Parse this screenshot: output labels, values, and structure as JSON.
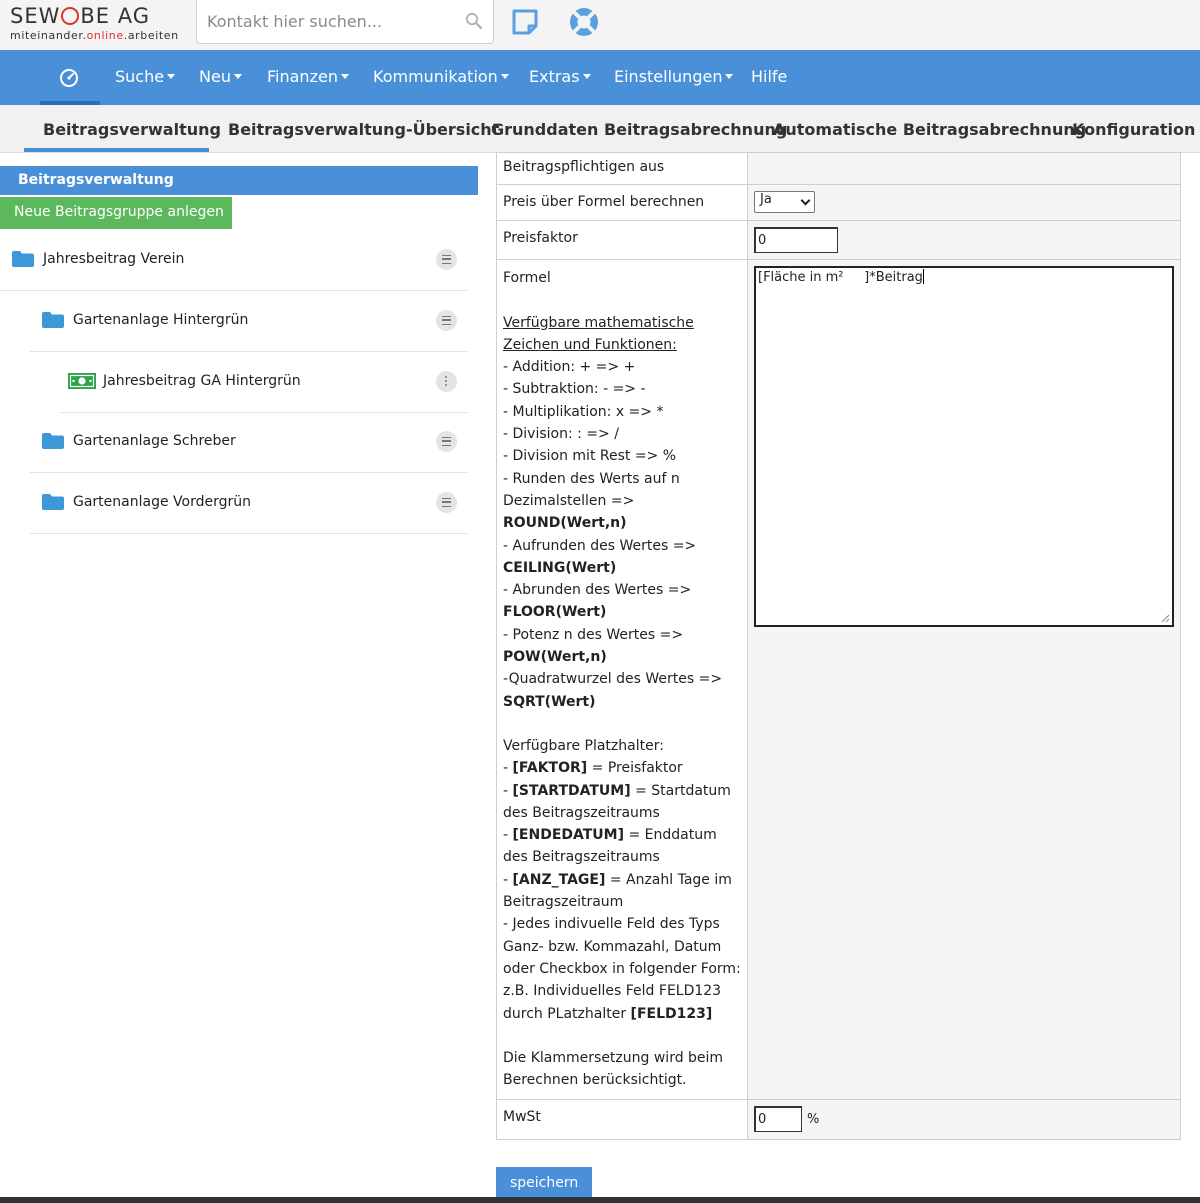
{
  "logo": {
    "main": "SEWOBE AG",
    "sub_prefix": "miteinander.",
    "sub_online": "online",
    "sub_suffix": ".arbeiten"
  },
  "search": {
    "placeholder": "Kontakt hier suchen..."
  },
  "nav": {
    "items": [
      {
        "label": "Suche",
        "dropdown": true
      },
      {
        "label": "Neu",
        "dropdown": true
      },
      {
        "label": "Finanzen",
        "dropdown": true
      },
      {
        "label": "Kommunikation",
        "dropdown": true
      },
      {
        "label": "Extras",
        "dropdown": true
      },
      {
        "label": "Einstellungen",
        "dropdown": true
      },
      {
        "label": "Hilfe",
        "dropdown": false
      }
    ]
  },
  "tabs": [
    "Beitragsverwaltung",
    "Beitragsverwaltung-Übersicht",
    "Grunddaten Beitragsabrechnung",
    "Automatische Beitragsabrechnung",
    "Konfiguration Beitragsverwaltung"
  ],
  "sidebar": {
    "header": "Beitragsverwaltung",
    "new_group_button": "Neue Beitragsgruppe anlegen",
    "tree": [
      {
        "label": "Jahresbeitrag Verein",
        "icon": "folder-icon"
      },
      {
        "label": "Gartenanlage Hintergrün",
        "icon": "folder-icon"
      },
      {
        "label": "Jahresbeitrag GA Hintergrün",
        "icon": "money-icon"
      },
      {
        "label": "Gartenanlage Schreber",
        "icon": "folder-icon"
      },
      {
        "label": "Gartenanlage Vordergrün",
        "icon": "folder-icon"
      }
    ]
  },
  "form": {
    "row_payers_label": "Beitragspflichtigen aus",
    "price_formula_label": "Preis über Formel berechnen",
    "price_formula_value": "Ja",
    "price_factor_label": "Preisfaktor",
    "price_factor_value": "0",
    "formula_label": "Formel",
    "formula_value": "[Fläche in m²     ]*Beitrag",
    "help": {
      "math_heading_1": "Verfügbare mathematische",
      "math_heading_2": "Zeichen und Funktionen:",
      "add": "- Addition: + => +",
      "sub": "- Subtraktion: - => -",
      "mul": "- Multiplikation: x => *",
      "div": "- Division: : => /",
      "mod": "- Division mit Rest => %",
      "round_1": "- Runden des Werts auf n",
      "round_2": "Dezimalstellen =>",
      "round_fn": "ROUND(Wert,n)",
      "ceil_1": "- Aufrunden des Wertes =>",
      "ceil_fn": "CEILING(Wert)",
      "floor_1": "- Abrunden des Wertes =>",
      "floor_fn": "FLOOR(Wert)",
      "pow_1": "- Potenz n des Wertes =>",
      "pow_fn": "POW(Wert,n)",
      "sqrt_1": "-Quadratwurzel des Wertes =>",
      "sqrt_fn": "SQRT(Wert)",
      "placeholder_heading": "Verfügbare Platzhalter:",
      "ph_factor_code": "[FAKTOR]",
      "ph_factor_desc": " = Preisfaktor",
      "ph_start_code": "[STARTDATUM]",
      "ph_start_desc": " = Startdatum des Beitragszeitraums",
      "ph_end_code": "[ENDEDATUM]",
      "ph_end_desc": " = Enddatum des Beitragszeitraums",
      "ph_days_code": "[ANZ_TAGE]",
      "ph_days_desc": " = Anzahl Tage im Beitragszeitraum",
      "custom_1": "- Jedes indivuelle Feld des Typs Ganz- bzw. Kommazahl, Datum oder Checkbox in folgender Form:",
      "custom_2": "z.B. Individuelles Feld FELD123 durch PLatzhalter ",
      "custom_code": "[FELD123]",
      "brackets_note": "Die Klammersetzung wird beim Berechnen berücksichtigt."
    },
    "vat_label": "MwSt",
    "vat_value": "0",
    "vat_unit": "%"
  },
  "save_button": "speichern",
  "colors": {
    "nav_blue": "#4a90d9",
    "green_button": "#5cb85c",
    "folder_blue": "#3d98d8",
    "money_green": "#2ea24a"
  }
}
